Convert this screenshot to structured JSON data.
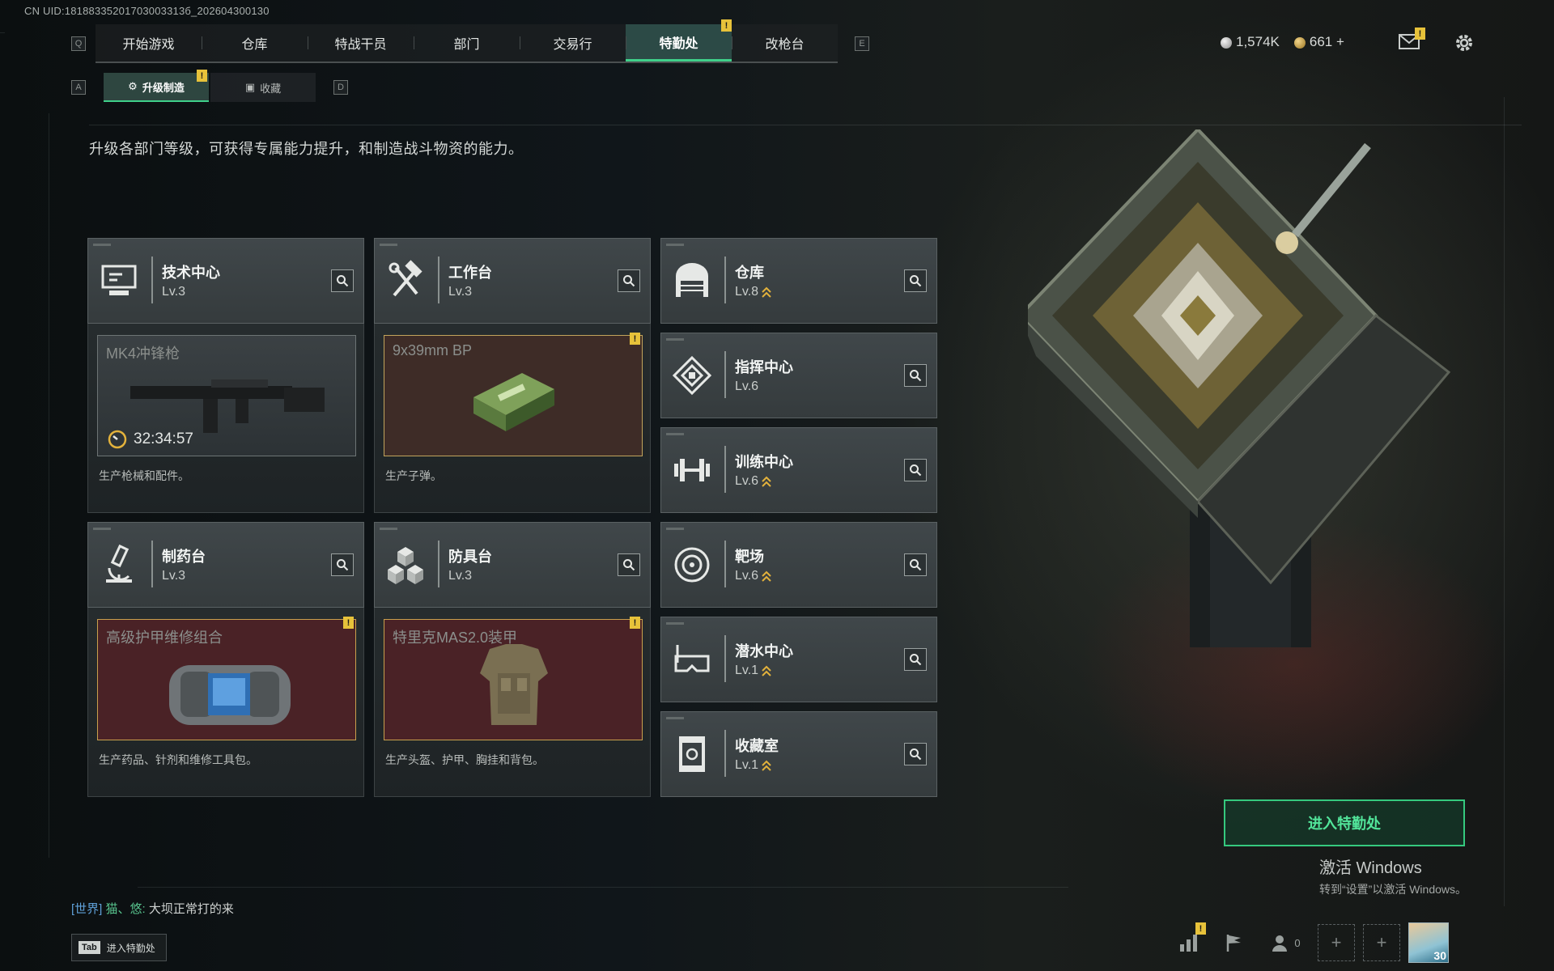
{
  "uid_text": "CN UID:18188335201703003313б_202604300130",
  "nav": {
    "left_key": "Q",
    "right_key": "E",
    "tabs": [
      {
        "label": "开始游戏"
      },
      {
        "label": "仓库"
      },
      {
        "label": "特战干员"
      },
      {
        "label": "部门"
      },
      {
        "label": "交易行"
      },
      {
        "label": "特勤处",
        "active": true,
        "alert": true
      },
      {
        "label": "改枪台"
      }
    ]
  },
  "currency": {
    "silver": "1,574K",
    "gold": "661",
    "gold_add": "+"
  },
  "subtabs": {
    "left_key": "A",
    "right_key": "D",
    "items": [
      {
        "label": "升级制造",
        "active": true,
        "alert": true
      },
      {
        "label": "收藏"
      }
    ]
  },
  "description": "升级各部门等级，可获得专属能力提升，和制造战斗物资的能力。",
  "production_departments": [
    {
      "name": "技术中心",
      "level": "Lv.3",
      "icon": "monitor-icon",
      "item": {
        "name": "MK4冲锋枪",
        "timer": "32:34:57",
        "style": "gray"
      },
      "desc": "生产枪械和配件。"
    },
    {
      "name": "工作台",
      "level": "Lv.3",
      "icon": "hammer-wrench-icon",
      "item": {
        "name": "9x39mm BP",
        "style": "brown",
        "alert": true
      },
      "desc": "生产子弹。"
    },
    {
      "name": "制药台",
      "level": "Lv.3",
      "icon": "microscope-icon",
      "item": {
        "name": "高级护甲维修组合",
        "style": "red",
        "alert": true
      },
      "desc": "生产药品、针剂和维修工具包。"
    },
    {
      "name": "防具台",
      "level": "Lv.3",
      "icon": "cubes-icon",
      "item": {
        "name": "特里克MAS2.0装甲",
        "style": "red",
        "alert": true
      },
      "desc": "生产头盔、护甲、胸挂和背包。"
    }
  ],
  "other_departments": [
    {
      "name": "仓库",
      "level": "Lv.8",
      "icon": "warehouse-icon",
      "upgrade": true
    },
    {
      "name": "指挥中心",
      "level": "Lv.6",
      "icon": "command-chip-icon",
      "upgrade": false
    },
    {
      "name": "训练中心",
      "level": "Lv.6",
      "icon": "dumbbell-icon",
      "upgrade": true
    },
    {
      "name": "靶场",
      "level": "Lv.6",
      "icon": "target-icon",
      "upgrade": true
    },
    {
      "name": "潜水中心",
      "level": "Lv.1",
      "icon": "diving-mask-icon",
      "upgrade": true
    },
    {
      "name": "收藏室",
      "level": "Lv.1",
      "icon": "collection-cabinet-icon",
      "upgrade": true
    }
  ],
  "enter_button": "进入特勤处",
  "activate_windows": {
    "title": "激活 Windows",
    "subtitle": "转到“设置”以激活 Windows。"
  },
  "chat": {
    "channel": "[世界]",
    "name": "猫、悠:",
    "message": "大坝正常打的来"
  },
  "tab_hint": {
    "key": "Tab",
    "label": "进入特勤处"
  },
  "bottom_bar": {
    "friends_count": "0",
    "slot_plus": "+",
    "avatar_level": "30"
  },
  "colors": {
    "accent_green": "#3fd08a",
    "alert_yellow": "#e7c23a",
    "upgrade_gold": "#e3b23c"
  }
}
